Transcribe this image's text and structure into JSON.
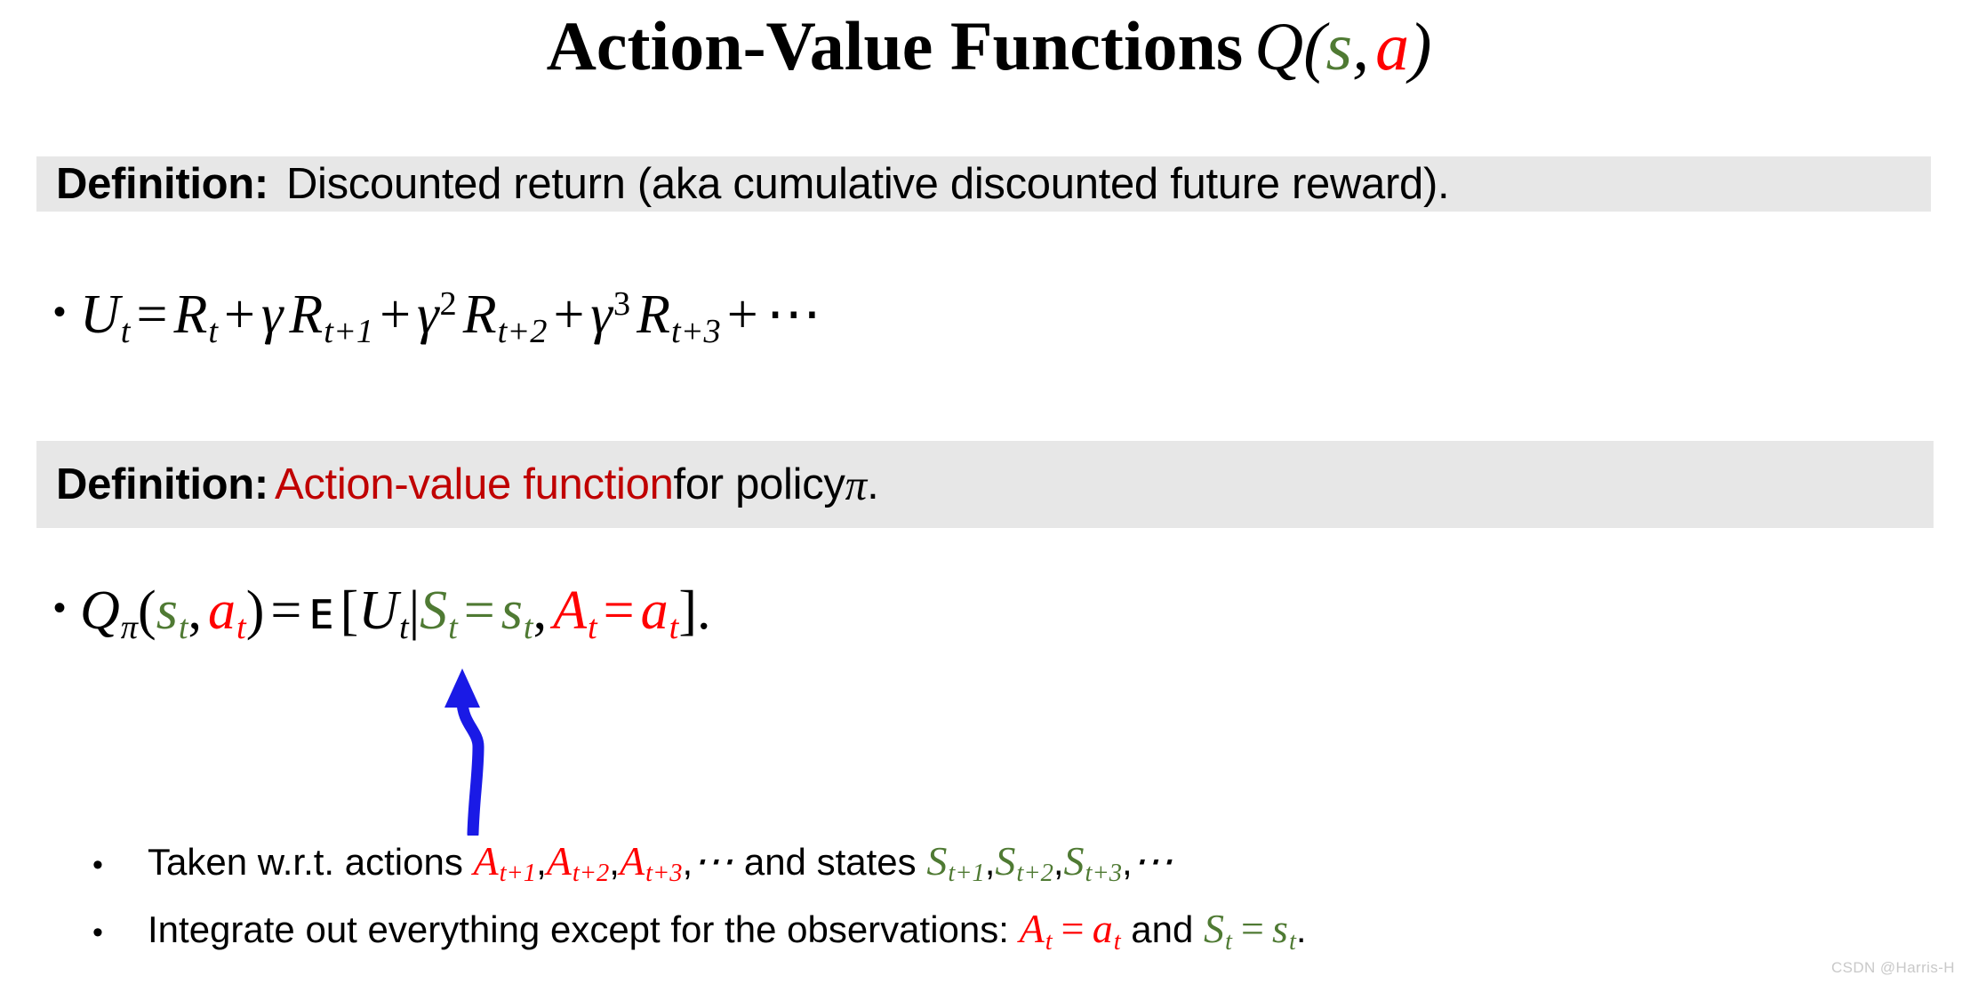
{
  "slide": {
    "title": {
      "main": "Action-Value Functions",
      "math_q": "Q",
      "math_open_paren": "(",
      "math_s": "s",
      "math_comma": ",",
      "math_a": "a",
      "math_close_paren": ")"
    },
    "definition_1": {
      "label": "Definition:",
      "text": "Discounted return (aka cumulative discounted future reward)."
    },
    "formula_return": {
      "bullet": "•",
      "lhs": "U",
      "lhs_sub": "t",
      "equals": "=",
      "term1": "R",
      "term1_sub": "t",
      "plus": "+",
      "gamma": "γ",
      "term2": "R",
      "term2_sub": "t+1",
      "gamma2_exp": "2",
      "term3": "R",
      "term3_sub": "t+2",
      "gamma3_exp": "3",
      "term4": "R",
      "term4_sub": "t+3",
      "ellipsis": "⋯"
    },
    "definition_2": {
      "label": "Definition:",
      "accent_text": "Action-value function",
      "tail_text": " for policy ",
      "pi": "π",
      "period": "."
    },
    "formula_qvalue": {
      "bullet": "•",
      "q": "Q",
      "q_sub_pi": "π",
      "open_paren": "(",
      "s": "s",
      "s_sub": "t",
      "comma": ",",
      "a": "a",
      "a_sub": "t",
      "close_paren": ")",
      "equals": "=",
      "expectation": "ᴇ",
      "open_bracket": "[",
      "u": "U",
      "u_sub": "t",
      "given": "|",
      "S": "S",
      "S_sub": "t",
      "eq_s": "=",
      "s2": "s",
      "s2_sub": "t",
      "comma2": ",",
      "A": "A",
      "A_sub": "t",
      "eq_a": "=",
      "a2": "a",
      "a2_sub": "t",
      "close_bracket": "]",
      "period": "."
    },
    "notes": [
      {
        "bullet": "•",
        "pre": "Taken w.r.t. actions ",
        "actions": "A",
        "a1_sub": "t+1",
        "a2_sub": "t+2",
        "a3_sub": "t+3",
        "comma": ",",
        "ellipsis": "⋯",
        "mid": " and states ",
        "states": "S",
        "s1_sub": "t+1",
        "s2_sub": "t+2",
        "s3_sub": "t+3"
      },
      {
        "bullet": "•",
        "pre": "Integrate out everything except for the observations: ",
        "A": "A",
        "A_sub": "t",
        "equals": "=",
        "a": "a",
        "a_sub": "t",
        "mid": " and ",
        "S": "S",
        "S_sub": "t",
        "equals2": "=",
        "s": "s",
        "s_sub": "t",
        "period": "."
      }
    ],
    "annotation_arrow": {
      "name": "expectation-pointer",
      "color": "#1a1ae6",
      "direction": "up"
    },
    "watermark": "CSDN @Harris-H",
    "colors": {
      "state_green": "#4f7a33",
      "action_red": "#ff0000",
      "accent_dark_red": "#c00000",
      "band_gray": "#e7e7e7",
      "arrow_blue": "#1a1ae6",
      "watermark_gray": "#c9c9c9"
    }
  }
}
